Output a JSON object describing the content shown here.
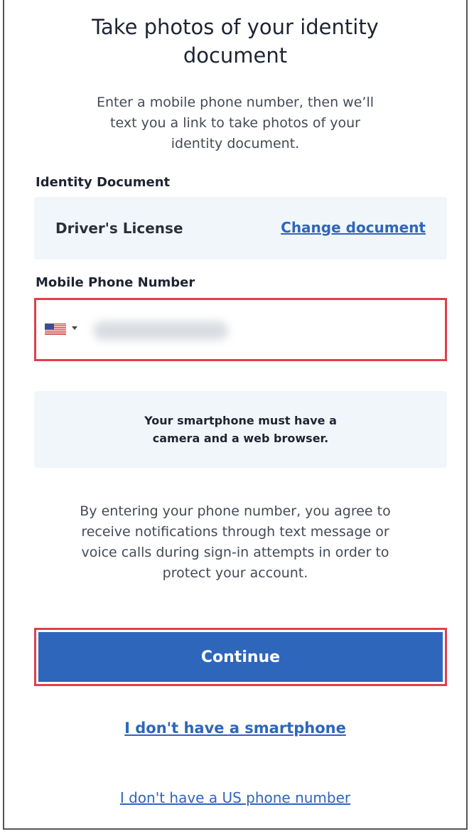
{
  "header": {
    "title": "Take photos of your identity document",
    "intro": "Enter a mobile phone number, then we’ll text you a link to take photos of your identity document."
  },
  "document": {
    "label": "Identity Document",
    "selected": "Driver's License",
    "change_link": "Change document"
  },
  "phone": {
    "label": "Mobile Phone Number",
    "country_icon": "us-flag-icon",
    "value": ""
  },
  "info": {
    "text": "Your smartphone must have a camera and a web browser."
  },
  "consent": {
    "text": "By entering your phone number, you agree to receive notifications through text message or voice calls during sign-in attempts in order to protect your account."
  },
  "actions": {
    "continue_label": "Continue",
    "no_smartphone_link": "I don't have a smartphone",
    "no_us_number_link": "I don't have a US phone number"
  },
  "colors": {
    "accent": "#2e66bb",
    "highlight_border": "#e0404a",
    "panel_bg": "#f1f6fb"
  }
}
